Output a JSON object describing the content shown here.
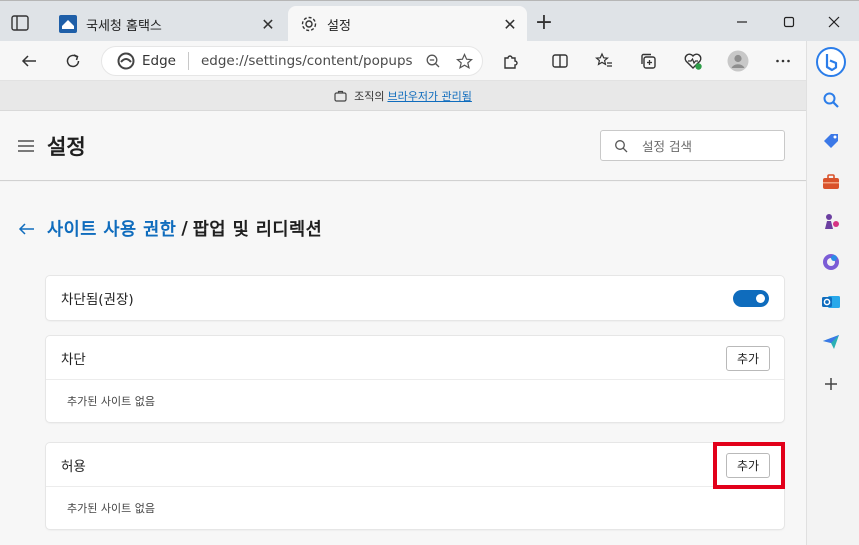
{
  "tabs": [
    {
      "title": "국세청 홈택스",
      "active": false
    },
    {
      "title": "설정",
      "active": true
    }
  ],
  "address": {
    "brand": "Edge",
    "url": "edge://settings/content/popups"
  },
  "banner": {
    "prefix": "조직의",
    "link": "브라우저가 관리됨"
  },
  "settings": {
    "title": "설정",
    "search_placeholder": "설정 검색"
  },
  "breadcrumb": {
    "parent": "사이트 사용 권한",
    "separator": "/",
    "current": "팝업 및 리디렉션"
  },
  "blocked_toggle": {
    "label": "차단됨(권장)",
    "on": true
  },
  "block_section": {
    "label": "차단",
    "add_label": "추가",
    "empty_text": "추가된 사이트 없음"
  },
  "allow_section": {
    "label": "허용",
    "add_label": "추가",
    "empty_text": "추가된 사이트 없음"
  },
  "colors": {
    "accent": "#0f6cbd",
    "highlight": "#e2001a"
  }
}
